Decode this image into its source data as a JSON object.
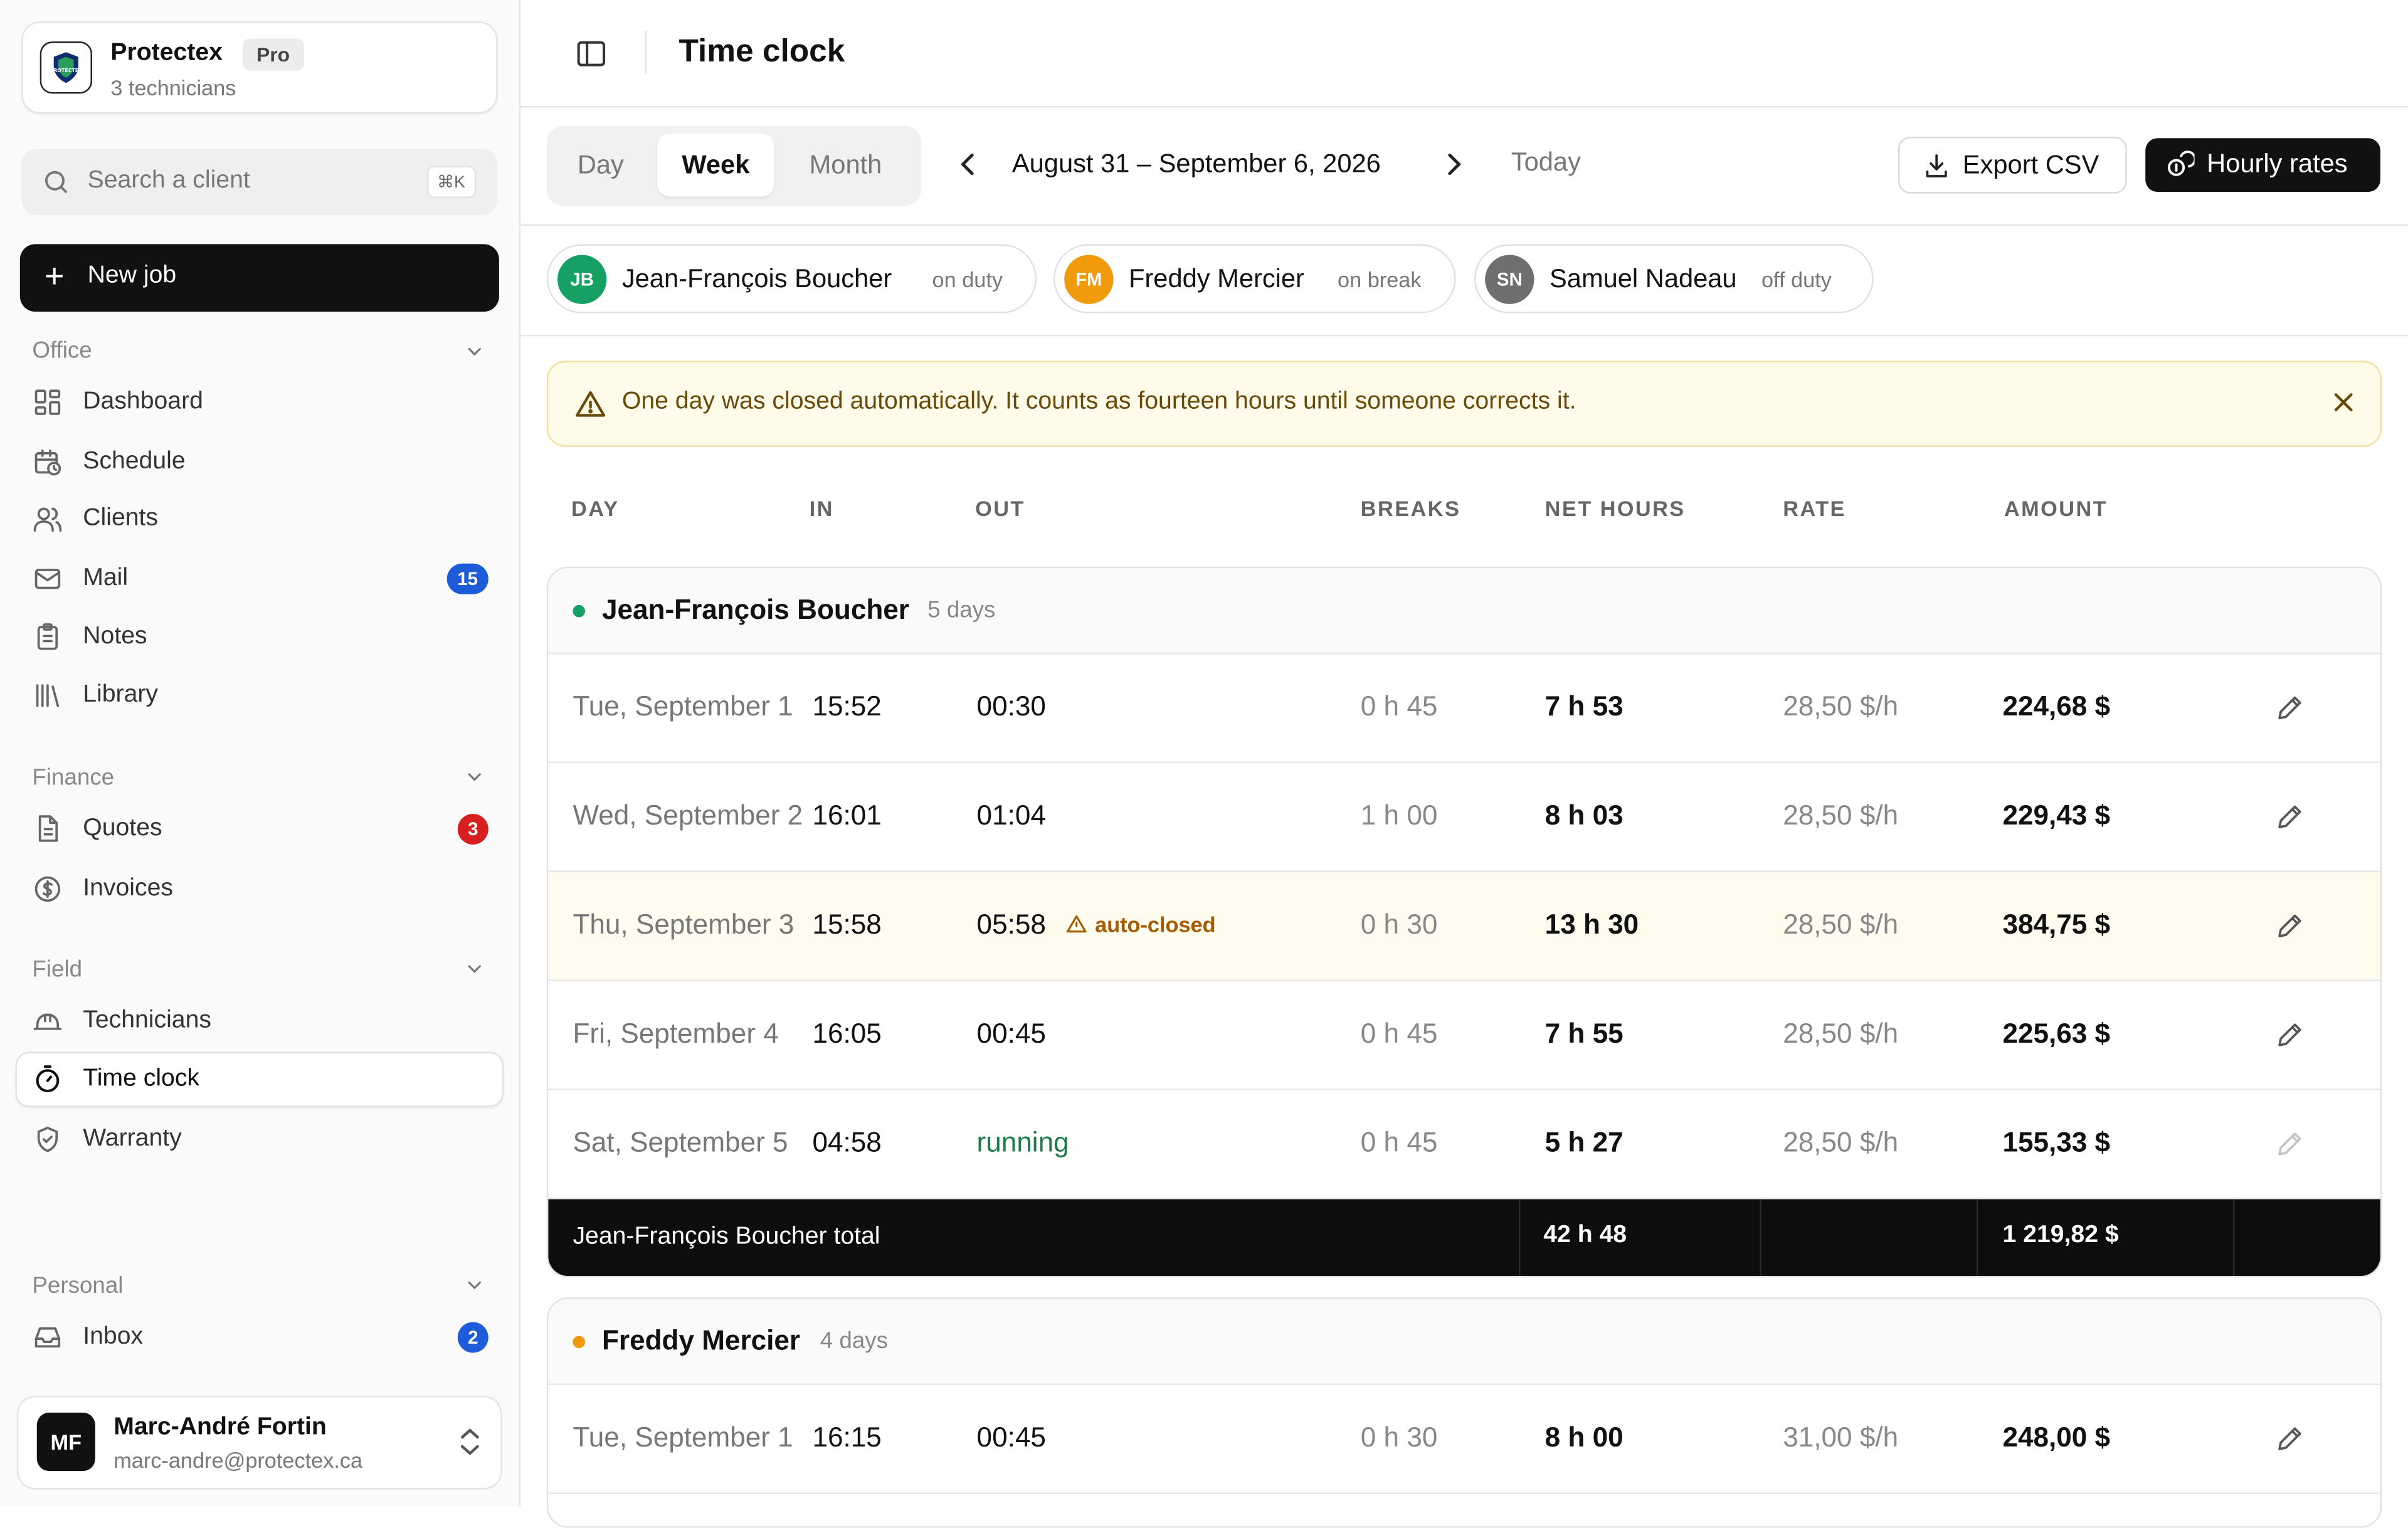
{
  "brand": {
    "name": "Protectex",
    "badge": "Pro",
    "subtitle": "3 technicians",
    "logo_text": "PROTECTEX"
  },
  "search": {
    "placeholder": "Search a client",
    "shortcut": "⌘K"
  },
  "new_job": {
    "label": "New job"
  },
  "sidebar": {
    "sections": [
      {
        "label": "Office",
        "items": [
          {
            "label": "Dashboard",
            "icon": "grid-icon"
          },
          {
            "label": "Schedule",
            "icon": "calendar-clock-icon"
          },
          {
            "label": "Clients",
            "icon": "users-icon"
          },
          {
            "label": "Mail",
            "icon": "mail-icon",
            "count": "15",
            "count_color": "#1d5bd8"
          },
          {
            "label": "Notes",
            "icon": "clipboard-icon"
          },
          {
            "label": "Library",
            "icon": "library-icon"
          }
        ]
      },
      {
        "label": "Finance",
        "items": [
          {
            "label": "Quotes",
            "icon": "document-icon",
            "count": "3",
            "count_color": "#d71f1f"
          },
          {
            "label": "Invoices",
            "icon": "dollar-circle-icon"
          }
        ]
      },
      {
        "label": "Field",
        "items": [
          {
            "label": "Technicians",
            "icon": "hard-hat-icon"
          },
          {
            "label": "Time clock",
            "icon": "stopwatch-icon",
            "active": true
          },
          {
            "label": "Warranty",
            "icon": "shield-check-icon"
          }
        ]
      },
      {
        "label": "Personal",
        "items": [
          {
            "label": "Inbox",
            "icon": "inbox-icon",
            "count": "2",
            "count_color": "#1d5bd8"
          }
        ]
      }
    ]
  },
  "user": {
    "initials": "MF",
    "name": "Marc-André Fortin",
    "email": "marc-andre@protectex.ca"
  },
  "header": {
    "title": "Time clock"
  },
  "toolbar": {
    "periods": [
      "Day",
      "Week",
      "Month"
    ],
    "active_period": "Week",
    "range": "August 31 – September 6, 2026",
    "today": "Today",
    "export_label": "Export CSV",
    "rates_label": "Hourly rates"
  },
  "technicians": [
    {
      "initials": "JB",
      "name": "Jean-François Boucher",
      "status": "on duty",
      "color": "#16a064"
    },
    {
      "initials": "FM",
      "name": "Freddy Mercier",
      "status": "on break",
      "color": "#f29a0e"
    },
    {
      "initials": "SN",
      "name": "Samuel Nadeau",
      "status": "off duty",
      "color": "#6f6f6f"
    }
  ],
  "alert": {
    "message": "One day was closed automatically. It counts as fourteen hours until someone corrects it."
  },
  "table": {
    "columns": [
      "DAY",
      "IN",
      "OUT",
      "BREAKS",
      "NET HOURS",
      "RATE",
      "AMOUNT"
    ],
    "groups": [
      {
        "name": "Jean-François Boucher",
        "days": "5 days",
        "dot_color": "#16a064",
        "rows": [
          {
            "day": "Tue, September 1",
            "in": "15:52",
            "out": "00:30",
            "breaks": "0 h 45",
            "net": "7 h 53",
            "rate": "28,50 $/h",
            "amount": "224,68 $"
          },
          {
            "day": "Wed, September 2",
            "in": "16:01",
            "out": "01:04",
            "breaks": "1 h 00",
            "net": "8 h 03",
            "rate": "28,50 $/h",
            "amount": "229,43 $"
          },
          {
            "day": "Thu, September 3",
            "in": "15:58",
            "out": "05:58",
            "flag": "auto-closed",
            "breaks": "0 h 30",
            "net": "13 h 30",
            "rate": "28,50 $/h",
            "amount": "384,75 $"
          },
          {
            "day": "Fri, September 4",
            "in": "16:05",
            "out": "00:45",
            "breaks": "0 h 45",
            "net": "7 h 55",
            "rate": "28,50 $/h",
            "amount": "225,63 $"
          },
          {
            "day": "Sat, September 5",
            "in": "04:58",
            "out": "running",
            "breaks": "0 h 45",
            "net": "5 h 27",
            "rate": "28,50 $/h",
            "amount": "155,33 $"
          }
        ],
        "total_label": "Jean-François Boucher total",
        "total_net": "42 h 48",
        "total_amount": "1 219,82 $"
      },
      {
        "name": "Freddy Mercier",
        "days": "4 days",
        "dot_color": "#f29a0e",
        "rows": [
          {
            "day": "Tue, September 1",
            "in": "16:15",
            "out": "00:45",
            "breaks": "0 h 30",
            "net": "8 h 00",
            "rate": "31,00 $/h",
            "amount": "248,00 $"
          }
        ]
      }
    ]
  }
}
